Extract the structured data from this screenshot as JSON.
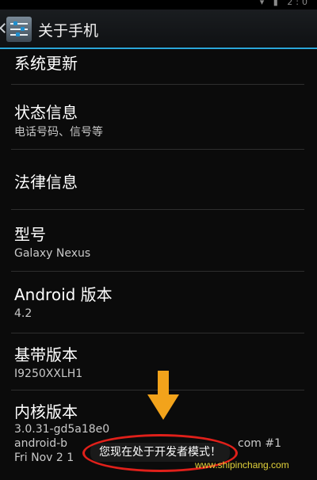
{
  "status_bar": {
    "icons_text": "▾ ▮ 2:0"
  },
  "action_bar": {
    "title": "关于手机"
  },
  "items": [
    {
      "title": "系统更新"
    },
    {
      "title": "状态信息",
      "subtitle": "电话号码、信号等"
    },
    {
      "title": "法律信息"
    },
    {
      "title": "型号",
      "subtitle": "Galaxy Nexus"
    },
    {
      "title": "Android 版本",
      "subtitle": "4.2"
    },
    {
      "title": "基带版本",
      "subtitle": "I9250XXLH1"
    },
    {
      "title": "内核版本",
      "lines": [
        "3.0.31-gd5a18e0",
        "android-b",
        "Fri Nov 2 1"
      ],
      "line2_suffix": "com #1"
    }
  ],
  "toast": {
    "text": "您现在处于开发者模式！"
  },
  "watermark": "www.shipinchang.com",
  "colors": {
    "accent": "#2aa6d8",
    "annotation_red": "#e0201a",
    "annotation_orange": "#f2a31b"
  }
}
